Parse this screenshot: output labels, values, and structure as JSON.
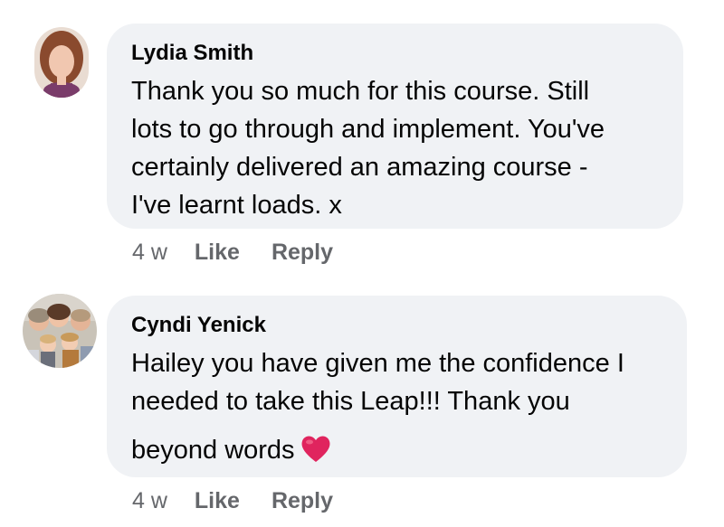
{
  "comments": [
    {
      "author": "Lydia Smith",
      "lines": [
        "Thank you so much for this course.  Still",
        "lots to go through and implement.  You've",
        "certainly delivered an amazing course -",
        "I've learnt loads.  x"
      ],
      "timestamp": "4 w",
      "like_label": "Like",
      "reply_label": "Reply",
      "avatar_icon": "profile-photo-woman"
    },
    {
      "author": "Cyndi Yenick",
      "lines": [
        "Hailey you have given me the confidence I",
        "needed to take this Leap!!! Thank you",
        "beyond words"
      ],
      "trailing_emoji": "red-heart-icon",
      "timestamp": "4 w",
      "like_label": "Like",
      "reply_label": "Reply",
      "avatar_icon": "profile-photo-family"
    }
  ],
  "colors": {
    "bubble_bg": "#f0f2f5",
    "meta_text": "#65676b",
    "heart": "#e0245e"
  }
}
